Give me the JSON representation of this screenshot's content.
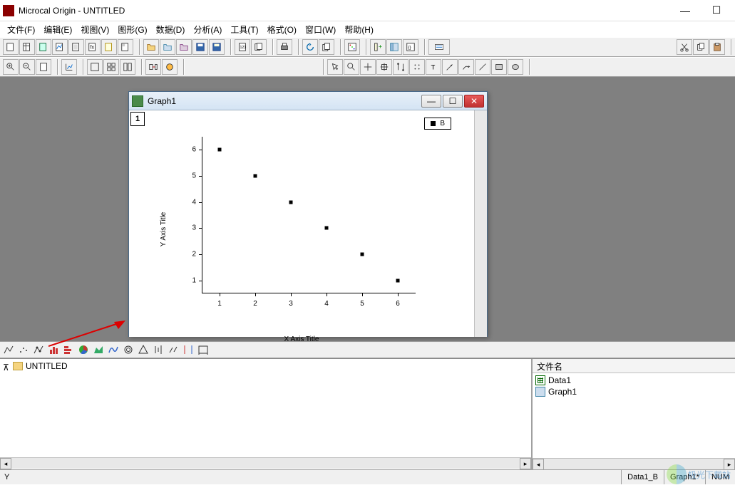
{
  "titlebar": {
    "title": "Microcal Origin - UNTITLED"
  },
  "menu": [
    "文件(F)",
    "编辑(E)",
    "视图(V)",
    "图形(G)",
    "数据(D)",
    "分析(A)",
    "工具(T)",
    "格式(O)",
    "窗口(W)",
    "帮助(H)"
  ],
  "graph_window": {
    "title": "Graph1",
    "layer": "1",
    "legend": "B"
  },
  "chart_data": {
    "type": "scatter",
    "x": [
      1,
      2,
      3,
      4,
      5,
      6
    ],
    "y": [
      6,
      5,
      4,
      3,
      2,
      1
    ],
    "series_name": "B",
    "xlabel": "X Axis Title",
    "ylabel": "Y Axis Title",
    "xticks": [
      1,
      2,
      3,
      4,
      5,
      6
    ],
    "yticks": [
      1,
      2,
      3,
      4,
      5,
      6
    ],
    "xlim": [
      0.5,
      6.5
    ],
    "ylim": [
      0.5,
      6.5
    ]
  },
  "project": {
    "root": "UNTITLED"
  },
  "file_panel": {
    "header": "文件名",
    "items": [
      {
        "name": "Data1",
        "type": "data"
      },
      {
        "name": "Graph1",
        "type": "graph"
      }
    ]
  },
  "status": {
    "left": "Y",
    "cells": [
      "Data1_B",
      "Graph1*",
      "NUM"
    ]
  },
  "watermark": "极光下载站"
}
